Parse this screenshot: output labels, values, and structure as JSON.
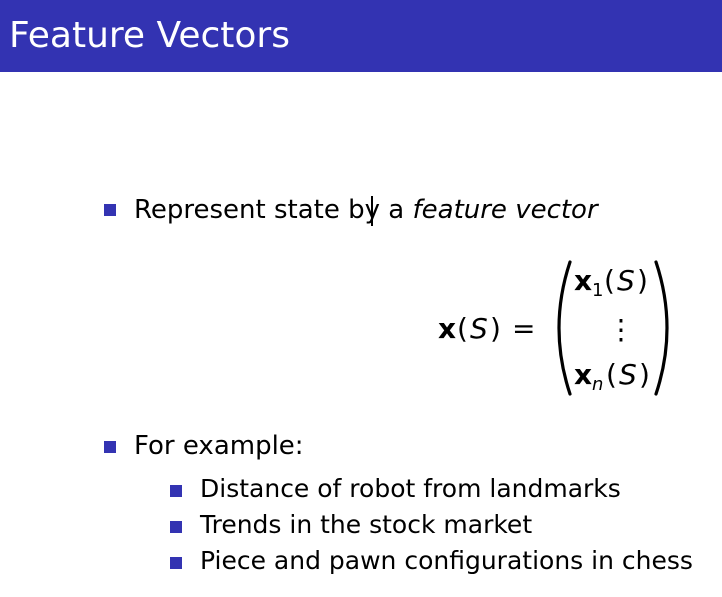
{
  "slide": {
    "title": "Feature Vectors",
    "colors": {
      "accent": "#3333b2",
      "title_text": "#ffffff"
    }
  },
  "bullets": [
    {
      "text_before": "Represent state by a ",
      "text_emphasis": "feature vector"
    },
    {
      "text": "For example:",
      "sub_items": [
        "Distance of robot from landmarks",
        "Trends in the stock market",
        "Piece and pawn configurations in chess"
      ]
    }
  ],
  "equation": {
    "lhs_vector": "x",
    "lhs_arg": "S",
    "equals": "=",
    "open_paren": "(",
    "close_paren": ")",
    "entries": [
      {
        "vector": "x",
        "subscript": "1",
        "arg": "S"
      },
      {
        "ellipsis": "⋮"
      },
      {
        "vector": "x",
        "subscript": "n",
        "arg": "S"
      }
    ]
  }
}
